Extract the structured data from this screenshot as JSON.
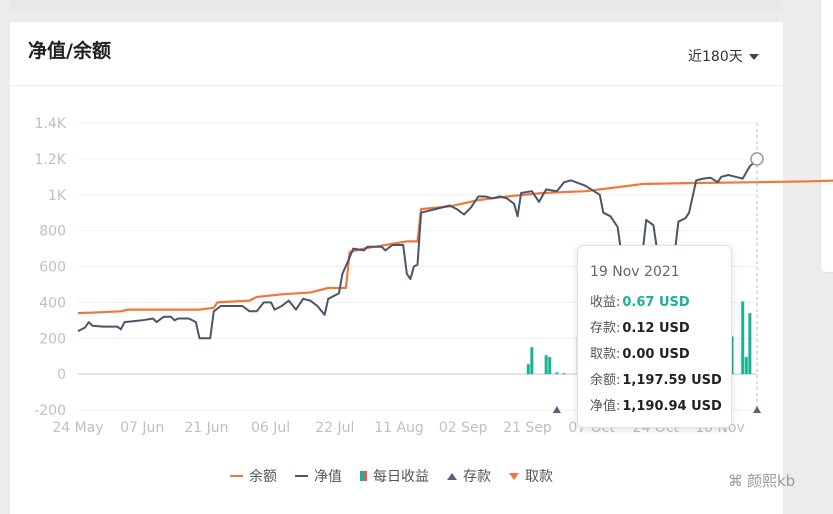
{
  "card": {
    "title": "净值/余额",
    "range_label": "近180天"
  },
  "colors": {
    "balance": "#f0773e",
    "net_value": "#4a5568",
    "gain": "#19b394",
    "loss": "#e05a5a",
    "deposit": "#55637a",
    "withdraw": "#f0773e"
  },
  "chart_data": {
    "type": "line",
    "x_labels": [
      "24 May",
      "07 Jun",
      "21 Jun",
      "06 Jul",
      "22 Jul",
      "11 Aug",
      "02 Sep",
      "21 Sep",
      "07 Oct",
      "24 Oct",
      "10 Nov"
    ],
    "y_ticks": [
      "1.4K",
      "1.2K",
      "1K",
      "800",
      "600",
      "400",
      "200",
      "0",
      "-200"
    ],
    "ylim": [
      -200,
      1400
    ],
    "grid": true,
    "legend_position": "bottom",
    "series": [
      {
        "name": "余额",
        "type": "line",
        "points": [
          [
            0,
            340
          ],
          [
            7,
            345
          ],
          [
            12,
            350
          ],
          [
            14,
            360
          ],
          [
            34,
            360
          ],
          [
            38,
            370
          ],
          [
            39,
            400
          ],
          [
            48,
            410
          ],
          [
            50,
            430
          ],
          [
            57,
            445
          ],
          [
            65,
            455
          ],
          [
            70,
            480
          ],
          [
            75,
            480
          ],
          [
            76,
            680
          ],
          [
            80,
            700
          ],
          [
            86,
            720
          ],
          [
            92,
            740
          ],
          [
            95,
            740
          ],
          [
            96,
            920
          ],
          [
            104,
            935
          ],
          [
            112,
            970
          ],
          [
            120,
            990
          ],
          [
            130,
            1010
          ],
          [
            142,
            1020
          ],
          [
            150,
            1040
          ],
          [
            158,
            1060
          ],
          [
            170,
            1065
          ],
          [
            190,
            1070
          ],
          [
            205,
            1075
          ],
          [
            213,
            1080
          ],
          [
            215,
            1110
          ],
          [
            218,
            1130
          ],
          [
            221,
            1200
          ]
        ]
      },
      {
        "name": "净值",
        "type": "line",
        "points": [
          [
            0,
            240
          ],
          [
            2,
            260
          ],
          [
            3,
            290
          ],
          [
            4,
            270
          ],
          [
            7,
            265
          ],
          [
            11,
            265
          ],
          [
            12,
            250
          ],
          [
            13,
            290
          ],
          [
            18,
            300
          ],
          [
            21,
            310
          ],
          [
            22,
            290
          ],
          [
            24,
            320
          ],
          [
            26,
            320
          ],
          [
            27,
            300
          ],
          [
            28,
            310
          ],
          [
            31,
            310
          ],
          [
            33,
            290
          ],
          [
            34,
            200
          ],
          [
            37,
            200
          ],
          [
            38,
            350
          ],
          [
            40,
            380
          ],
          [
            46,
            380
          ],
          [
            48,
            350
          ],
          [
            50,
            350
          ],
          [
            52,
            400
          ],
          [
            54,
            400
          ],
          [
            55,
            360
          ],
          [
            57,
            380
          ],
          [
            59,
            410
          ],
          [
            61,
            360
          ],
          [
            63,
            420
          ],
          [
            65,
            410
          ],
          [
            67,
            380
          ],
          [
            69,
            330
          ],
          [
            70,
            420
          ],
          [
            73,
            450
          ],
          [
            74,
            560
          ],
          [
            76,
            650
          ],
          [
            77,
            700
          ],
          [
            80,
            690
          ],
          [
            81,
            710
          ],
          [
            85,
            710
          ],
          [
            86,
            690
          ],
          [
            88,
            720
          ],
          [
            91,
            720
          ],
          [
            92,
            560
          ],
          [
            93,
            530
          ],
          [
            94,
            600
          ],
          [
            95,
            610
          ],
          [
            96,
            900
          ],
          [
            100,
            920
          ],
          [
            104,
            940
          ],
          [
            106,
            920
          ],
          [
            108,
            890
          ],
          [
            110,
            930
          ],
          [
            112,
            990
          ],
          [
            114,
            990
          ],
          [
            116,
            980
          ],
          [
            118,
            990
          ],
          [
            120,
            980
          ],
          [
            122,
            950
          ],
          [
            123,
            880
          ],
          [
            124,
            1010
          ],
          [
            127,
            1020
          ],
          [
            129,
            960
          ],
          [
            131,
            1030
          ],
          [
            134,
            1020
          ],
          [
            136,
            1070
          ],
          [
            138,
            1080
          ],
          [
            142,
            1050
          ],
          [
            146,
            1000
          ],
          [
            147,
            900
          ],
          [
            149,
            880
          ],
          [
            151,
            820
          ],
          [
            152,
            680
          ],
          [
            154,
            640
          ],
          [
            156,
            700
          ],
          [
            158,
            680
          ],
          [
            159,
            860
          ],
          [
            161,
            830
          ],
          [
            162,
            700
          ],
          [
            163,
            560
          ],
          [
            165,
            600
          ],
          [
            167,
            680
          ],
          [
            168,
            850
          ],
          [
            170,
            870
          ],
          [
            171,
            900
          ],
          [
            173,
            1080
          ],
          [
            175,
            1090
          ],
          [
            177,
            1095
          ],
          [
            179,
            1070
          ],
          [
            180,
            1100
          ],
          [
            182,
            1110
          ],
          [
            184,
            1100
          ],
          [
            186,
            1090
          ],
          [
            188,
            1160
          ],
          [
            190,
            1190.94
          ]
        ]
      },
      {
        "name": "每日收益",
        "type": "bar",
        "values": [
          [
            126,
            55
          ],
          [
            127,
            150
          ],
          [
            131,
            105
          ],
          [
            132,
            95
          ],
          [
            134,
            10
          ],
          [
            136,
            5
          ],
          [
            140,
            205
          ],
          [
            141,
            200
          ],
          [
            150,
            70
          ],
          [
            152,
            160
          ],
          [
            154,
            120
          ],
          [
            183,
            210
          ],
          [
            186,
            405
          ],
          [
            187,
            95
          ],
          [
            188,
            340
          ]
        ]
      }
    ],
    "markers": [
      {
        "name": "存款",
        "x": 134
      },
      {
        "name": "存款",
        "x": 190
      }
    ]
  },
  "legend": [
    {
      "label": "余额",
      "kind": "line",
      "color": "#f0773e"
    },
    {
      "label": "净值",
      "kind": "line",
      "color": "#4a5568"
    },
    {
      "label": "每日收益",
      "kind": "bar",
      "color": "#19b394",
      "color2": "#e05a5a"
    },
    {
      "label": "存款",
      "kind": "tri-up",
      "color": "#55637a"
    },
    {
      "label": "取款",
      "kind": "tri-down",
      "color": "#f0773e"
    }
  ],
  "tooltip": {
    "date": "19 Nov 2021",
    "rows": [
      {
        "label": "收益:",
        "value": "0.67 USD",
        "color": "#19b394"
      },
      {
        "label": "存款:",
        "value": "0.12 USD"
      },
      {
        "label": "取款:",
        "value": "0.00 USD"
      },
      {
        "label": "余额:",
        "value": "1,197.59 USD"
      },
      {
        "label": "净值:",
        "value": "1,190.94 USD"
      }
    ]
  },
  "watermark": "颜熙kb"
}
